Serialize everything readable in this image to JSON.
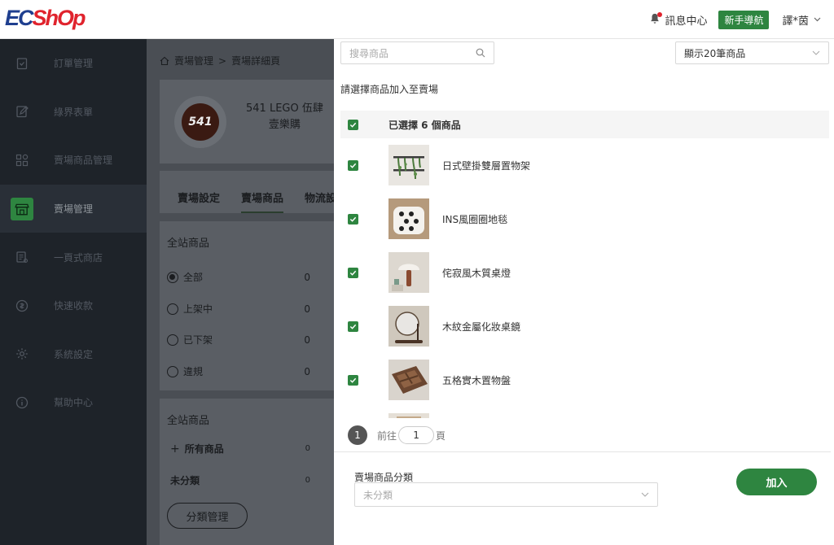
{
  "header": {
    "logo_ec": "EC",
    "logo_shop": "ShOp",
    "messages_label": "訊息中心",
    "guide_label": "新手導航",
    "user_name": "譯*茵"
  },
  "sidebar": {
    "items": [
      {
        "label": "訂單管理",
        "icon": "clipboard-icon"
      },
      {
        "label": "綠界表單",
        "icon": "edit-form-icon"
      },
      {
        "label": "賣場商品管理",
        "icon": "grid-shapes-icon"
      },
      {
        "label": "賣場管理",
        "icon": "store-icon",
        "active": true
      },
      {
        "label": "一頁式商店",
        "icon": "page-store-icon"
      },
      {
        "label": "快速收款",
        "icon": "coin-icon"
      },
      {
        "label": "系統設定",
        "icon": "gear-icon"
      },
      {
        "label": "幫助中心",
        "icon": "info-icon"
      }
    ]
  },
  "breadcrumb": {
    "home": "賣場管理",
    "separator": ">",
    "current": "賣場詳細頁"
  },
  "store": {
    "logo_text": "541",
    "name_line1": "541 LEGO 伍肆",
    "name_line2": "壹樂購"
  },
  "tabs": [
    {
      "label": "賣場設定"
    },
    {
      "label": "賣場商品",
      "active": true
    },
    {
      "label": "物流設"
    }
  ],
  "filter_panel": {
    "title": "全站商品",
    "options": [
      {
        "label": "全部",
        "count": "0",
        "selected": true
      },
      {
        "label": "上架中",
        "count": "0"
      },
      {
        "label": "已下架",
        "count": "0"
      },
      {
        "label": "違規",
        "count": "0"
      }
    ]
  },
  "category_panel": {
    "title": "全站商品",
    "all_label": "所有商品",
    "all_count": "0",
    "uncat_label": "未分類",
    "uncat_count": "0",
    "manage_button": "分類管理"
  },
  "drawer": {
    "search_placeholder": "搜尋商品",
    "page_size": "顯示20筆商品",
    "hint": "請選擇商品加入至賣場",
    "selected_summary": "已選擇 6 個商品",
    "products": [
      {
        "name": "日式壁掛雙層置物架",
        "checked": true
      },
      {
        "name": "INS風圈圈地毯",
        "checked": true
      },
      {
        "name": "侘寂風木質桌燈",
        "checked": true
      },
      {
        "name": "木紋金屬化妝桌鏡",
        "checked": true
      },
      {
        "name": "五格實木置物盤",
        "checked": true
      }
    ],
    "pager": {
      "current_page": "1",
      "goto_prefix": "前往",
      "goto_value": "1",
      "goto_suffix": "頁"
    },
    "category_label": "賣場商品分類",
    "category_value": "未分類",
    "join_button": "加入"
  },
  "colors": {
    "brand_green": "#2e8540",
    "logo_blue": "#1f3f8f",
    "logo_red": "#e0232d",
    "sidebar_bg": "#1e2329"
  }
}
